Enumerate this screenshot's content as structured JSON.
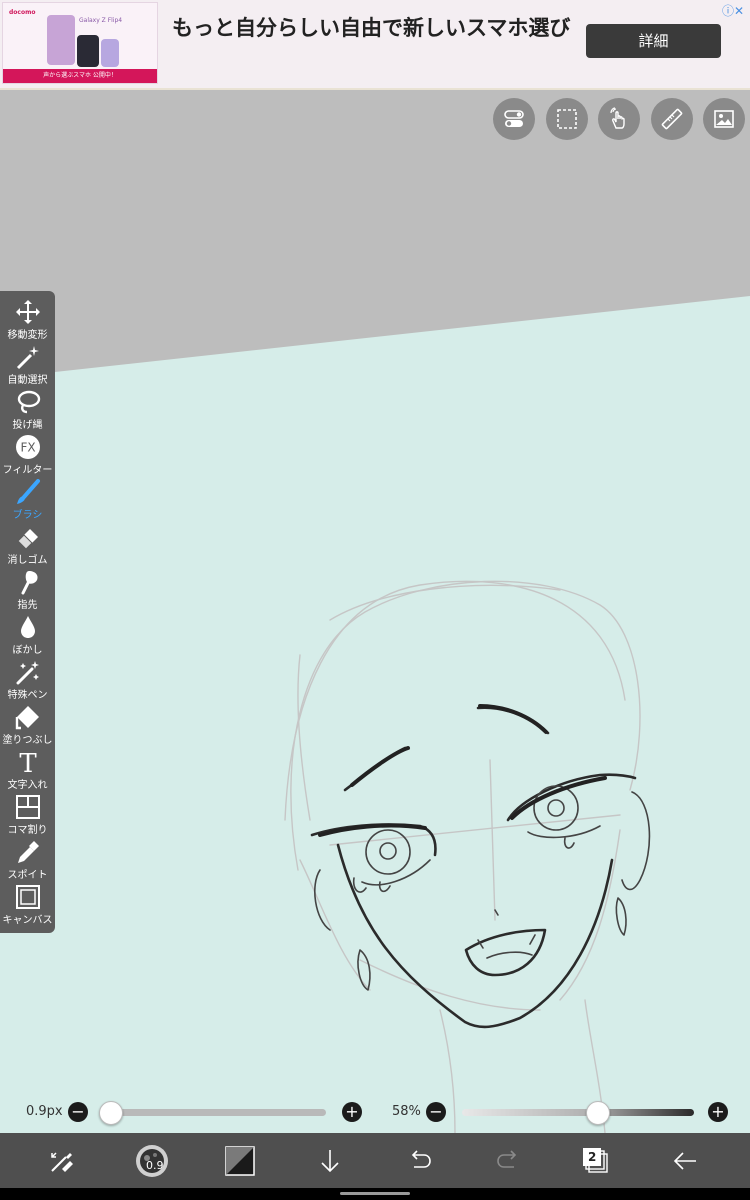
{
  "ad": {
    "headline": "もっと自分らしい自由で新しいスマホ選び",
    "button": "詳細",
    "thumb_brand": "docomo",
    "thumb_model": "Galaxy Z Flip4",
    "thumb_footer": "声から選ぶスマホ 公開中！"
  },
  "top_tools": [
    {
      "name": "toggle-icon"
    },
    {
      "name": "selection-icon"
    },
    {
      "name": "hand-gesture-icon"
    },
    {
      "name": "ruler-icon"
    },
    {
      "name": "image-icon"
    }
  ],
  "tools": [
    {
      "label": "移動変形",
      "icon": "move-icon"
    },
    {
      "label": "自動選択",
      "icon": "magic-wand-icon"
    },
    {
      "label": "投げ縄",
      "icon": "lasso-icon"
    },
    {
      "label": "フィルター",
      "icon": "fx-icon"
    },
    {
      "label": "ブラシ",
      "icon": "brush-icon",
      "active": true
    },
    {
      "label": "消しゴム",
      "icon": "eraser-icon"
    },
    {
      "label": "指先",
      "icon": "finger-icon"
    },
    {
      "label": "ぼかし",
      "icon": "blur-drop-icon"
    },
    {
      "label": "特殊ペン",
      "icon": "special-pen-icon"
    },
    {
      "label": "塗りつぶし",
      "icon": "fill-icon"
    },
    {
      "label": "文字入れ",
      "icon": "text-icon"
    },
    {
      "label": "コマ割り",
      "icon": "panel-icon"
    },
    {
      "label": "スポイト",
      "icon": "eyedropper-icon"
    },
    {
      "label": "キャンバス",
      "icon": "canvas-icon"
    }
  ],
  "sliders": {
    "brush_size": {
      "label": "0.9px",
      "value": 0.0
    },
    "opacity": {
      "label": "58%",
      "value": 0.58
    }
  },
  "bottom_bar": {
    "brush_size_badge": "0.9",
    "layer_count": "2"
  },
  "colors": {
    "canvas_bg": "#d6ede9",
    "outside_bg": "#bdbdbd",
    "toolbar_bg": "#5d5d5d",
    "active_tool": "#3ba6ff",
    "bottom_bar_bg": "#4f4f4f"
  }
}
